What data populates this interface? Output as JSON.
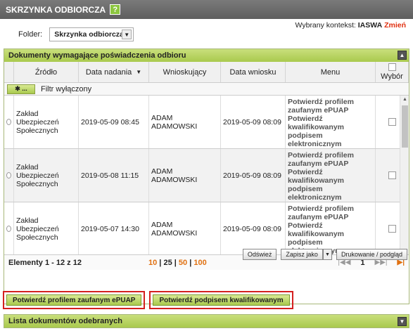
{
  "header": {
    "title": "SKRZYNKA ODBIORCZA",
    "help": "?"
  },
  "folder": {
    "label": "Folder:",
    "value": "Skrzynka odbiorcza"
  },
  "context": {
    "label": "Wybrany kontekst:",
    "value": "IASWA",
    "change": "Zmień"
  },
  "panel": {
    "title": "Dokumenty wymagające poświadczenia odbioru"
  },
  "table": {
    "headers": {
      "source": "Źródło",
      "sent_date": "Data nadania",
      "applicant": "Wnioskujący",
      "request_date": "Data wniosku",
      "menu": "Menu",
      "select": "Wybór"
    },
    "filter_label": "Filtr wyłączony",
    "rows": [
      {
        "source": "Zakład Ubezpieczeń Społecznych",
        "sent_date": "2019-05-09 08:45",
        "applicant": "ADAM ADAMOWSKI",
        "request_date": "2019-05-09 08:09",
        "menu": "Potwierdź profilem zaufanym ePUAP\nPotwierdź kwalifikowanym podpisem elektronicznym"
      },
      {
        "source": "Zakład Ubezpieczeń Społecznych",
        "sent_date": "2019-05-08 11:15",
        "applicant": "ADAM ADAMOWSKI",
        "request_date": "2019-05-09 08:09",
        "menu": "Potwierdź profilem zaufanym ePUAP\nPotwierdź kwalifikowanym podpisem elektronicznym"
      },
      {
        "source": "Zakład Ubezpieczeń Społecznych",
        "sent_date": "2019-05-07 14:30",
        "applicant": "ADAM ADAMOWSKI",
        "request_date": "2019-05-09 08:09",
        "menu": "Potwierdź profilem zaufanym ePUAP\nPotwierdź kwalifikowanym podpisem elektronicznym"
      }
    ]
  },
  "pager": {
    "elements": "Elementy 1 - 12 z 12",
    "sizes": [
      "10",
      "25",
      "50",
      "100"
    ],
    "page": "1"
  },
  "actions": {
    "refresh": "Odśwież",
    "save_as": "Zapisz jako",
    "print": "Drukowanie / podgląd"
  },
  "confirm": {
    "epuap": "Potwierdź profilem zaufanym ePUAP",
    "signature": "Potwierdź podpisem kwalifikowanym"
  },
  "received": {
    "title": "Lista dokumentów odebranych"
  }
}
